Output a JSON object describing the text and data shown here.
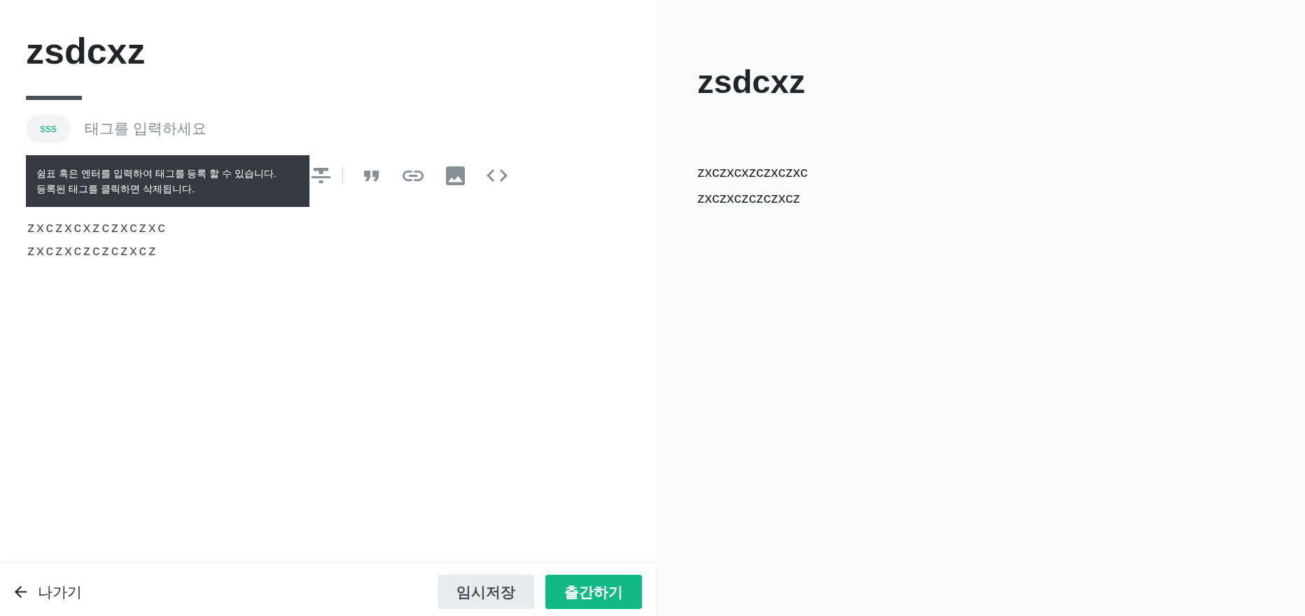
{
  "editor": {
    "title": "zsdcxz",
    "tags": [
      {
        "label": "sss"
      }
    ],
    "tag_input": {
      "placeholder": "태그를 입력하세요"
    },
    "tooltip": {
      "lines": [
        "쉼표 혹은 엔터를 입력하여 태그를 등록 할 수 있습니다.",
        "등록된 태그를 클릭하면 삭제됩니다."
      ]
    },
    "toolbar": [
      {
        "kind": "strikethrough"
      },
      {
        "kind": "divider"
      },
      {
        "kind": "quote"
      },
      {
        "kind": "link"
      },
      {
        "kind": "image"
      },
      {
        "kind": "code"
      }
    ],
    "body_lines": [
      "zxczxcxzczxczxc",
      "zxczxczczczxcz"
    ]
  },
  "footer": {
    "exit_label": "나가기",
    "buttons": [
      {
        "label": "임시저장",
        "kind": "secondary"
      },
      {
        "label": "출간하기",
        "kind": "primary"
      }
    ]
  },
  "preview": {
    "title": "zsdcxz",
    "paragraphs": [
      "zxczxcxzczxczxc",
      "zxczxczczczxcz"
    ]
  }
}
